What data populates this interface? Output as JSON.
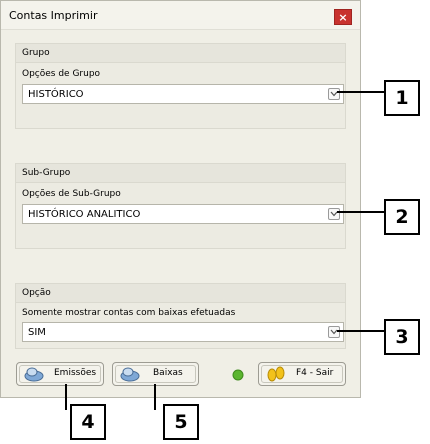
{
  "window": {
    "title": "Contas Imprimir",
    "close_label": "×"
  },
  "grupo": {
    "title": "Grupo",
    "label": "Opções de Grupo",
    "value": "HISTÓRICO"
  },
  "subgrupo": {
    "title": "Sub-Grupo",
    "label": "Opções de Sub-Grupo",
    "value": "HISTÓRICO ANALITICO"
  },
  "opcao": {
    "title": "Opção",
    "label": "Somente mostrar contas com baixas efetuadas",
    "value": "SIM"
  },
  "buttons": {
    "emissoes": "Emissões",
    "baixas": "Baixas",
    "sair": "F4 - Sair"
  },
  "callouts": [
    "1",
    "2",
    "3",
    "4",
    "5"
  ],
  "colors": {
    "close": "#c8322e",
    "window_bg": "#f0efe6",
    "status_dot": "#5bb52f"
  }
}
